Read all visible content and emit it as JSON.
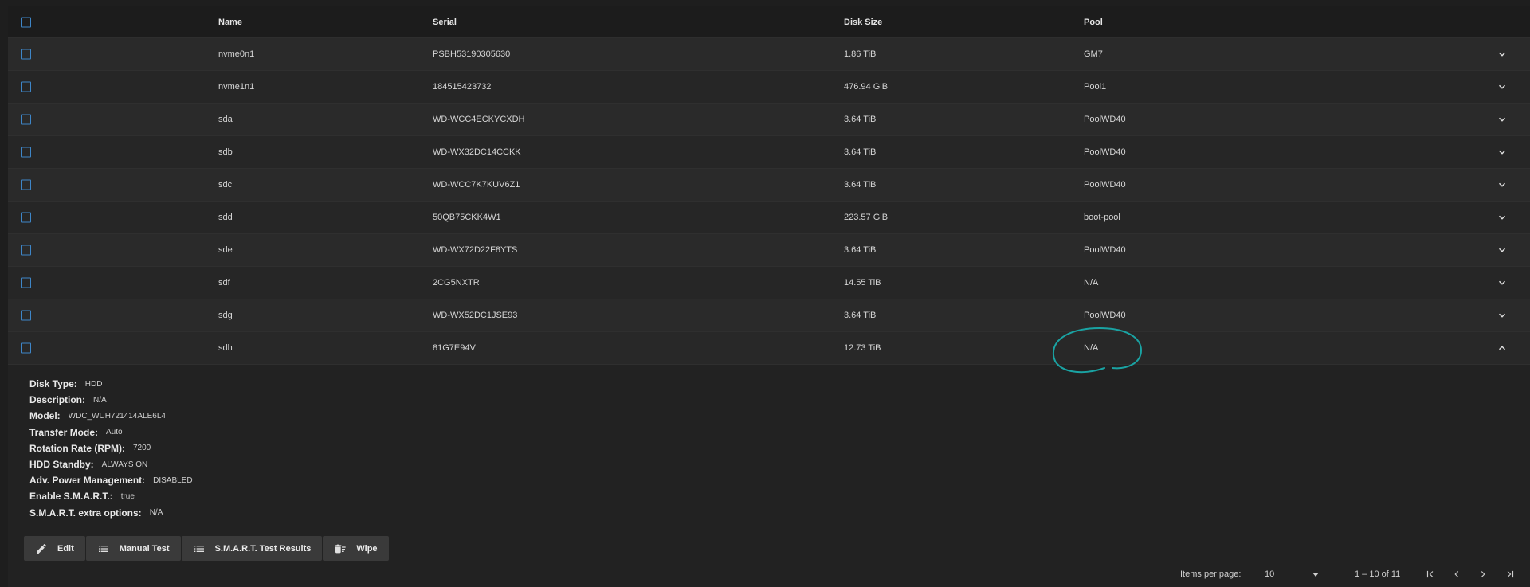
{
  "table": {
    "headers": {
      "name": "Name",
      "serial": "Serial",
      "disk_size": "Disk Size",
      "pool": "Pool"
    },
    "rows": [
      {
        "name": "nvme0n1",
        "serial": "PSBH53190305630",
        "size": "1.86 TiB",
        "pool": "GM7"
      },
      {
        "name": "nvme1n1",
        "serial": "184515423732",
        "size": "476.94 GiB",
        "pool": "Pool1"
      },
      {
        "name": "sda",
        "serial": "WD-WCC4ECKYCXDH",
        "size": "3.64 TiB",
        "pool": "PoolWD40"
      },
      {
        "name": "sdb",
        "serial": "WD-WX32DC14CCKK",
        "size": "3.64 TiB",
        "pool": "PoolWD40"
      },
      {
        "name": "sdc",
        "serial": "WD-WCC7K7KUV6Z1",
        "size": "3.64 TiB",
        "pool": "PoolWD40"
      },
      {
        "name": "sdd",
        "serial": "50QB75CKK4W1",
        "size": "223.57 GiB",
        "pool": "boot-pool"
      },
      {
        "name": "sde",
        "serial": "WD-WX72D22F8YTS",
        "size": "3.64 TiB",
        "pool": "PoolWD40"
      },
      {
        "name": "sdf",
        "serial": "2CG5NXTR",
        "size": "14.55 TiB",
        "pool": "N/A"
      },
      {
        "name": "sdg",
        "serial": "WD-WX52DC1JSE93",
        "size": "3.64 TiB",
        "pool": "PoolWD40"
      },
      {
        "name": "sdh",
        "serial": "81G7E94V",
        "size": "12.73 TiB",
        "pool": "N/A"
      }
    ]
  },
  "detail": {
    "fields": [
      {
        "key": "Disk Type:",
        "value": "HDD"
      },
      {
        "key": "Description:",
        "value": "N/A"
      },
      {
        "key": "Model:",
        "value": "WDC_WUH721414ALE6L4"
      },
      {
        "key": "Transfer Mode:",
        "value": "Auto"
      },
      {
        "key": "Rotation Rate (RPM):",
        "value": "7200"
      },
      {
        "key": "HDD Standby:",
        "value": "ALWAYS ON"
      },
      {
        "key": "Adv. Power Management:",
        "value": "DISABLED"
      },
      {
        "key": "Enable S.M.A.R.T.:",
        "value": "true"
      },
      {
        "key": "S.M.A.R.T. extra options:",
        "value": "N/A"
      }
    ],
    "actions": {
      "edit": "Edit",
      "manual_test": "Manual Test",
      "smart_results": "S.M.A.R.T. Test Results",
      "wipe": "Wipe"
    }
  },
  "pager": {
    "items_per_page_label": "Items per page:",
    "items_per_page_value": "10",
    "range": "1 – 10 of 11"
  },
  "colors": {
    "checkbox": "#3e86c8",
    "annotation": "#1aa3a3"
  }
}
